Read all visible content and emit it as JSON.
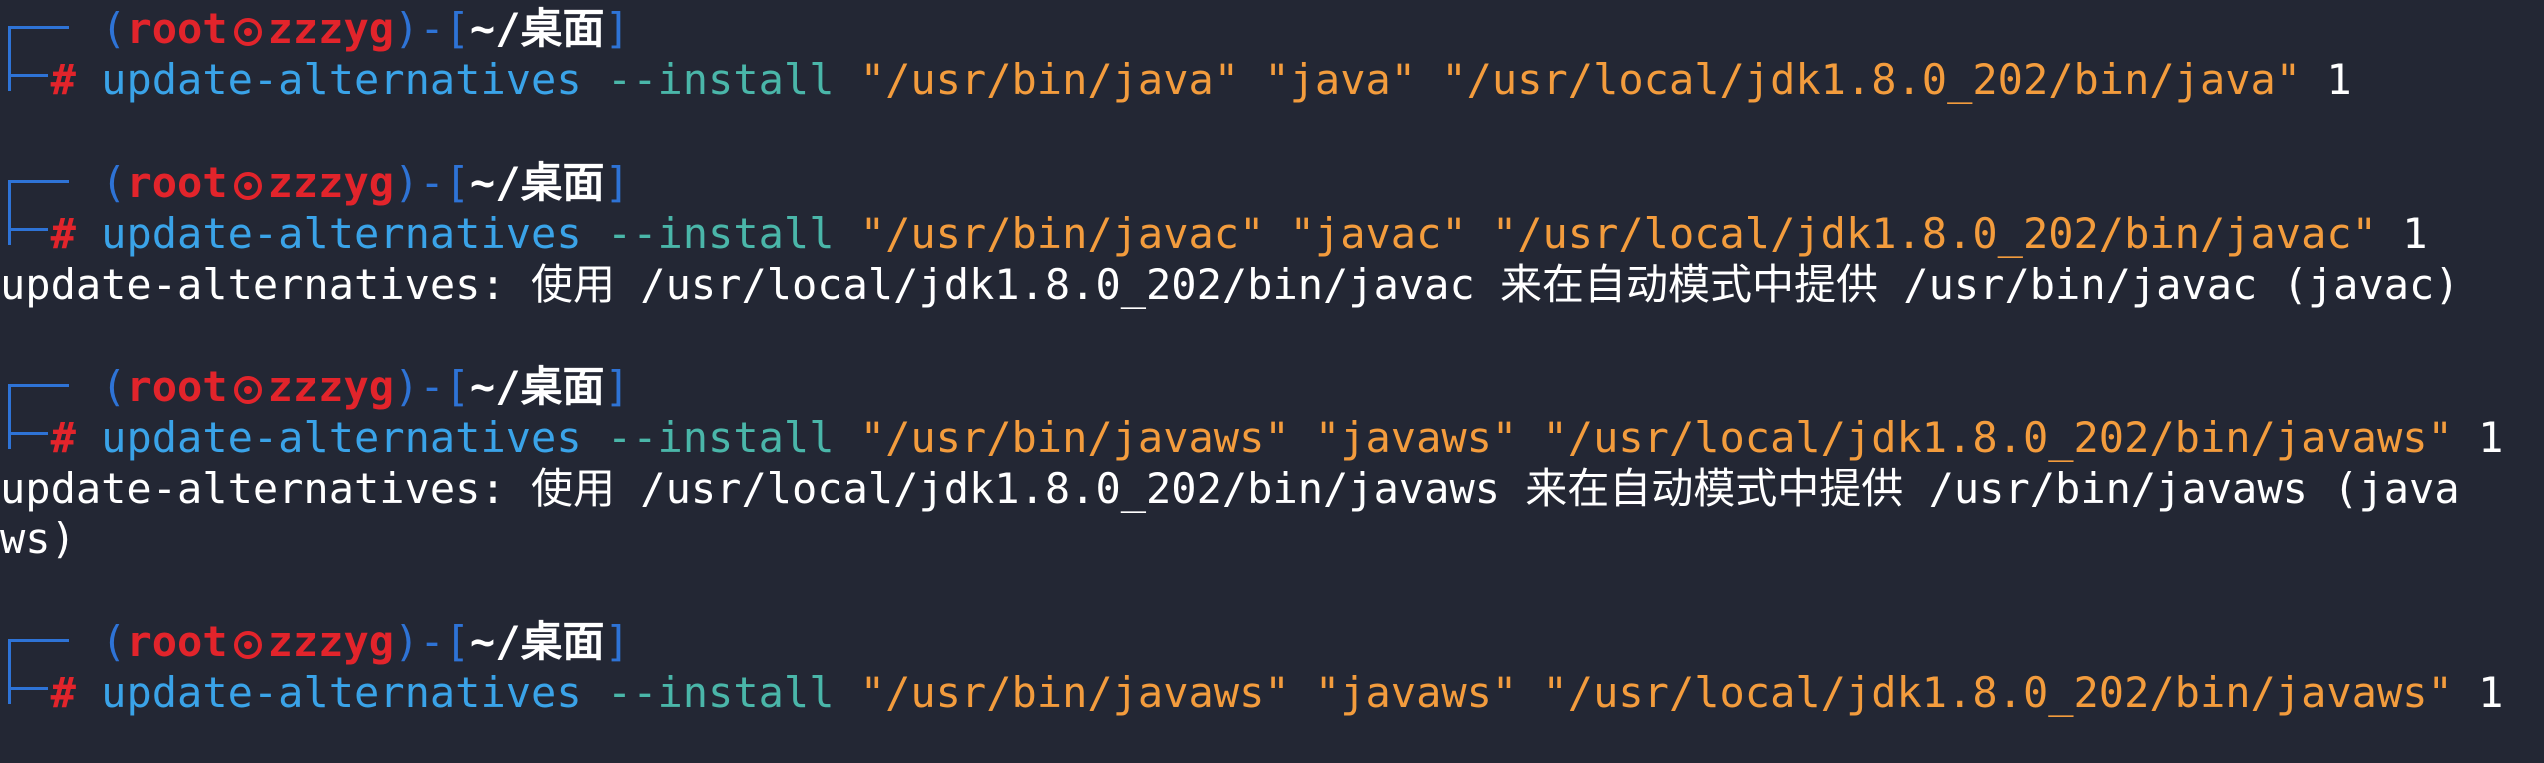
{
  "prompt": {
    "user": "root",
    "host": "zzzyg",
    "dir": "~/桌面",
    "open_bracket": "(",
    "close_bracket": ")",
    "dash": "-[",
    "close_dir": "]",
    "hash": "#"
  },
  "commands": [
    {
      "cmd": "update-alternatives",
      "opt": "--install",
      "args": "\"/usr/bin/java\" \"java\" \"/usr/local/jdk1.8.0_202/bin/java\"",
      "num": "1"
    },
    {
      "cmd": "update-alternatives",
      "opt": "--install",
      "args": "\"/usr/bin/javac\" \"javac\" \"/usr/local/jdk1.8.0_202/bin/javac\"",
      "num": "1"
    },
    {
      "cmd": "update-alternatives",
      "opt": "--install",
      "args": "\"/usr/bin/javaws\" \"javaws\" \"/usr/local/jdk1.8.0_202/bin/javaws\"",
      "num": "1"
    },
    {
      "cmd": "update-alternatives",
      "opt": "--install",
      "args": "\"/usr/bin/javaws\" \"javaws\" \"/usr/local/jdk1.8.0_202/bin/javaws\"",
      "num": "1"
    }
  ],
  "outputs": [
    "update-alternatives: 使用 /usr/local/jdk1.8.0_202/bin/javac 来在自动模式中提供 /usr/bin/javac (javac)",
    "update-alternatives: 使用 /usr/local/jdk1.8.0_202/bin/javaws 来在自动模式中提供 /usr/bin/javaws (java",
    "ws)"
  ],
  "colors": {
    "background": "#232734",
    "bracket_blue": "#2e73d6",
    "prompt_red": "#e2242b",
    "command_blue": "#3aa3e8",
    "option_teal": "#4ab6a9",
    "string_orange": "#f39c3d",
    "text_white": "#ffffff"
  },
  "icons": {
    "prompt_separator": "skull-icon"
  }
}
